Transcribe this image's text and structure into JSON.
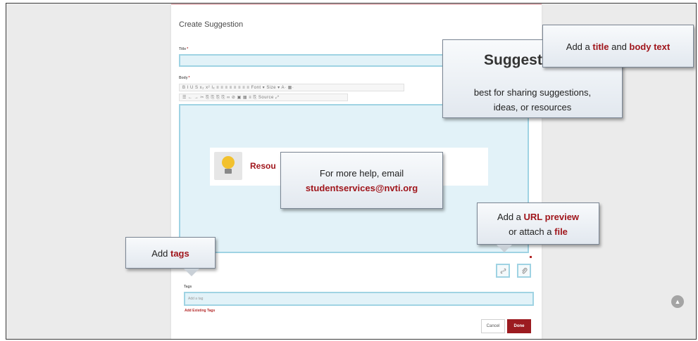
{
  "dialog": {
    "title": "Create Suggestion",
    "title_label": "Title",
    "body_label": "Body",
    "required_mark": "*",
    "toolbar_row1": "B  I  U  S  x₂  x²  Iₓ   ≡ ≡  ≡ ≡  ≡ ≡ ≡ ≡   Font  ▾   Size  ▾   A· ▦·",
    "toolbar_row2": "☰  ← →  ✂ ⎘ ⎘ ⎘ ⎘  ∞ ⊘  ▣ ▦ ≡  ⎘ Source  ⤢",
    "resource_title": "Resou",
    "tags_label": "Tags",
    "tags_placeholder": "Add a tag",
    "add_existing_tags": "Add Existing Tags",
    "cancel_label": "Cancel",
    "done_label": "Done"
  },
  "callouts": {
    "title_body": {
      "prefix": "Add a ",
      "title": "title",
      "mid": " and ",
      "body": "body text"
    },
    "suggestion_heading": "Suggestio",
    "suggestion_desc_line1": "best for sharing suggestions,",
    "suggestion_desc_line2": "ideas, or resources",
    "help_line1": "For more help, email",
    "help_email": "studentservices@nvti.org",
    "url_line1_prefix": "Add a ",
    "url_highlight": "URL preview",
    "url_line2_prefix": "or attach a ",
    "file_highlight": "file",
    "tags_prefix": "Add ",
    "tags_highlight": "tags"
  },
  "icons": {
    "link": "link-icon",
    "paperclip": "paperclip-icon",
    "scroll_top": "chevron-up-icon",
    "lightbulb": "lightbulb-icon"
  },
  "colors": {
    "accent_red": "#a0161c",
    "focus_blue": "#9fd3e3",
    "done_button": "#9c1b20"
  }
}
